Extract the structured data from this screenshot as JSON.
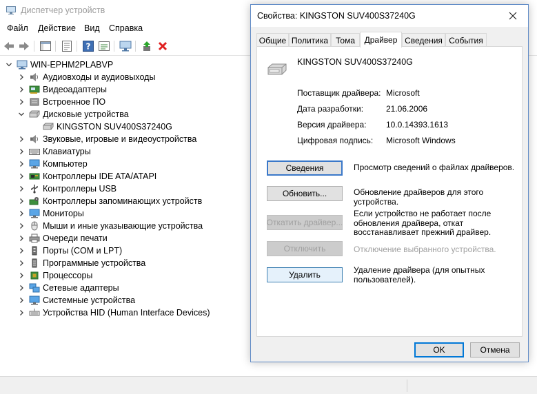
{
  "window": {
    "title": "Диспетчер устройств"
  },
  "menu": {
    "items": [
      "Файл",
      "Действие",
      "Вид",
      "Справка"
    ]
  },
  "toolbar": {
    "buttons": [
      "back-arrow-icon",
      "forward-arrow-icon",
      "show-hide-tree-icon",
      "properties-icon",
      "help-icon",
      "action-view-icon",
      "scan-hardware-icon",
      "update-driver-icon",
      "uninstall-icon"
    ]
  },
  "tree": {
    "root": "WIN-EPHM2PLABVP",
    "items": [
      {
        "label": "Аудиовходы и аудиовыходы",
        "icon": "speaker-icon",
        "expanded": false
      },
      {
        "label": "Видеоадаптеры",
        "icon": "display-adapter-icon",
        "expanded": false
      },
      {
        "label": "Встроенное ПО",
        "icon": "firmware-icon",
        "expanded": false
      },
      {
        "label": "Дисковые устройства",
        "icon": "disk-drive-icon",
        "expanded": true
      },
      {
        "label": "KINGSTON SUV400S37240G",
        "icon": "disk-drive-icon",
        "child": true
      },
      {
        "label": "Звуковые, игровые и видеоустройства",
        "icon": "speaker-icon",
        "expanded": false
      },
      {
        "label": "Клавиатуры",
        "icon": "keyboard-icon",
        "expanded": false
      },
      {
        "label": "Компьютер",
        "icon": "monitor-icon",
        "expanded": false
      },
      {
        "label": "Контроллеры IDE ATA/ATAPI",
        "icon": "ide-controller-icon",
        "expanded": false
      },
      {
        "label": "Контроллеры USB",
        "icon": "usb-icon",
        "expanded": false
      },
      {
        "label": "Контроллеры запоминающих устройств",
        "icon": "storage-controller-icon",
        "expanded": false
      },
      {
        "label": "Мониторы",
        "icon": "monitor-icon",
        "expanded": false
      },
      {
        "label": "Мыши и иные указывающие устройства",
        "icon": "mouse-icon",
        "expanded": false
      },
      {
        "label": "Очереди печати",
        "icon": "printer-icon",
        "expanded": false
      },
      {
        "label": "Порты (COM и LPT)",
        "icon": "port-icon",
        "expanded": false
      },
      {
        "label": "Программные устройства",
        "icon": "software-device-icon",
        "expanded": false
      },
      {
        "label": "Процессоры",
        "icon": "processor-icon",
        "expanded": false
      },
      {
        "label": "Сетевые адаптеры",
        "icon": "network-adapter-icon",
        "expanded": false
      },
      {
        "label": "Системные устройства",
        "icon": "system-device-icon",
        "expanded": false
      },
      {
        "label": "Устройства HID (Human Interface Devices)",
        "icon": "hid-icon",
        "expanded": false
      }
    ]
  },
  "dialog": {
    "title": "Свойства: KINGSTON SUV400S37240G",
    "tabs": [
      {
        "label": "Общие",
        "active": false
      },
      {
        "label": "Политика",
        "active": false
      },
      {
        "label": "Тома",
        "active": false
      },
      {
        "label": "Драйвер",
        "active": true
      },
      {
        "label": "Сведения",
        "active": false
      },
      {
        "label": "События",
        "active": false
      }
    ],
    "device_name": "KINGSTON SUV400S37240G",
    "properties": [
      {
        "label": "Поставщик драйвера:",
        "value": "Microsoft"
      },
      {
        "label": "Дата разработки:",
        "value": "21.06.2006"
      },
      {
        "label": "Версия драйвера:",
        "value": "10.0.14393.1613"
      },
      {
        "label": "Цифровая подпись:",
        "value": "Microsoft Windows"
      }
    ],
    "actions": [
      {
        "label": "Сведения",
        "desc": "Просмотр сведений о файлах драйверов.",
        "state": "focused"
      },
      {
        "label": "Обновить...",
        "desc": "Обновление драйверов для этого устройства.",
        "state": "normal"
      },
      {
        "label": "Откатить драйвер...",
        "desc": "Если устройство не работает после обновления драйвера, откат восстанавливает прежний драйвер.",
        "state": "disabled"
      },
      {
        "label": "Отключить",
        "desc": "Отключение выбранного устройства.",
        "state": "disabled"
      },
      {
        "label": "Удалить",
        "desc": "Удаление драйвера (для опытных пользователей).",
        "state": "hot"
      }
    ],
    "ok_label": "OK",
    "cancel_label": "Отмена"
  },
  "colors": {
    "accent": "#0078d7",
    "disabled_text": "#a0a0a0",
    "title_text": "#9a9a9a",
    "uninstall_red": "#e02020",
    "update_green": "#2aa52a"
  }
}
